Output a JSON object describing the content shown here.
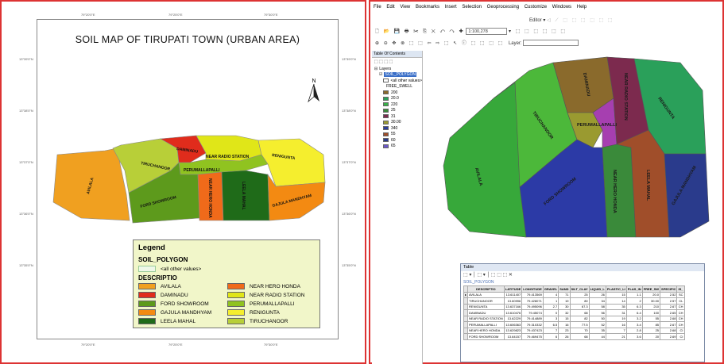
{
  "layout_view": {
    "map_title": "SOIL MAP OF TIRUPATI TOWN  (URBAN AREA)",
    "north_label": "N",
    "grid_ticks_top": [
      "79°20'0\"E",
      "79°25'0\"E",
      "79°30'0\"E"
    ],
    "grid_ticks_bottom": [
      "79°20'0\"E",
      "79°25'0\"E",
      "79°30'0\"E"
    ],
    "grid_ticks_left": [
      "13°39'0\"N",
      "13°38'0\"N",
      "13°37'0\"N",
      "13°36'0\"N",
      "13°35'0\"N"
    ],
    "grid_ticks_right": [
      "13°39'0\"N",
      "13°38'0\"N",
      "13°37'0\"N",
      "13°36'0\"N",
      "13°35'0\"N"
    ],
    "zone_labels": {
      "avilala": "AVILALA",
      "tiruchanoor": "TIRUCHANOOR",
      "daminadu": "DAMINADU",
      "near_radio_station": "NEAR RADIO STATION",
      "renigunta": "RENIGUNTA",
      "perumallapalli": "PERUMALLAPALLI",
      "ford_showroom": "FORD SHOWROOM",
      "near_hero_honda": "NEAR HERO HONDA",
      "leela_mahal": "LEELA MAHAL",
      "gajula_mandhyam": "GAJULA MANDHYAM"
    },
    "legend": {
      "title": "Legend",
      "layer": "SOIL_POLYGON",
      "other_values": "<all other values>",
      "field": "DESCRIPTIO",
      "items": [
        {
          "label": "AVILALA",
          "color": "#f0a020"
        },
        {
          "label": "DAMINADU",
          "color": "#e02c1c"
        },
        {
          "label": "FORD SHOWROOM",
          "color": "#5d9a1c"
        },
        {
          "label": "GAJULA MANDHYAM",
          "color": "#f38a12"
        },
        {
          "label": "LEELA MAHAL",
          "color": "#1f6b19"
        },
        {
          "label": "NEAR HERO HONDA",
          "color": "#f06a1a"
        },
        {
          "label": "NEAR RADIO STATION",
          "color": "#e0e618"
        },
        {
          "label": "PERUMALLAPALLI",
          "color": "#90c320"
        },
        {
          "label": "RENIGUNTA",
          "color": "#f5ee2e"
        },
        {
          "label": "TIRUCHANOOR",
          "color": "#b8cf38"
        }
      ]
    }
  },
  "arcmap": {
    "menu": [
      "File",
      "Edit",
      "View",
      "Bookmarks",
      "Insert",
      "Selection",
      "Geoprocessing",
      "Customize",
      "Windows",
      "Help"
    ],
    "editor_label": "Editor",
    "scale_value": "1:100,278",
    "layer_label": "Layer:",
    "toc": {
      "title": "Table Of Contents",
      "layers_label": "Layers",
      "layer_name": "SOIL_POLYGON",
      "other_values": "<all other values>",
      "field": "FREE_SWELL",
      "classes": [
        {
          "label": "200",
          "color": "#8a6a2c"
        },
        {
          "label": "20.0",
          "color": "#2aa05a"
        },
        {
          "label": "220",
          "color": "#38b048"
        },
        {
          "label": "25",
          "color": "#3a8a3a"
        },
        {
          "label": "31",
          "color": "#7c2a4e"
        },
        {
          "label": "30.00",
          "color": "#9a9a30"
        },
        {
          "label": "340",
          "color": "#2b3d9c"
        },
        {
          "label": "55",
          "color": "#a04e2a"
        },
        {
          "label": "60",
          "color": "#2a3b8c"
        },
        {
          "label": "65",
          "color": "#6b58c8"
        }
      ]
    },
    "map_labels": {
      "daminadu": "DAMINADU",
      "near_radio_station": "NEAR RADIO STATION",
      "renigunta": "RENIGUNTA",
      "tiruchanoor": "TIRUCHANOOR",
      "perumallapalli": "PERUMALLAPALLI",
      "avilala": "AVILALA",
      "ford_showroom": "FORD SHOWROOM",
      "near_hero_honda": "NEAR HERO HONDA",
      "leela_mahal": "LEELA MAHAL",
      "gajula_mandhyam": "GAJULA MANDHYAM"
    },
    "map_colors": {
      "avilala": "#37a83a",
      "tiruchanoor": "#4cb83a",
      "daminadu": "#8a6a2c",
      "perumallapalli": "#a63fb0",
      "near_radio_station": "#7c2a4e",
      "renigunta": "#2aa05a",
      "ford_showroom": "#2c3aa6",
      "near_hero_honda": "#3a8a3a",
      "leela_mahal": "#a04e2a",
      "gajula_mandhyam": "#2a3b8c",
      "north_strip": "#9a9a30"
    },
    "table": {
      "title": "Table",
      "layer_tab": "SOIL_POLYGON",
      "columns": [
        "DESCRIPTIO",
        "LATITUDE",
        "LONGITUDE",
        "GRAVEL",
        "SAND",
        "SILT_CLAY",
        "LIQUID_L",
        "PLASTIC_LI",
        "PLAS_IN",
        "FREE_SW",
        "SPECIFIC",
        "IS_"
      ],
      "rows": [
        [
          "AVILALA",
          "13.611407",
          "79.413569",
          "4",
          "71",
          "25",
          "26",
          "15",
          "1.1",
          "20.0",
          "2.52",
          "SC"
        ],
        [
          "TIRUCHANOOR",
          "13.60996",
          "79.428071",
          "1",
          "19",
          "80",
          "34",
          "14",
          "2",
          "30.00",
          "2.57",
          "CL"
        ],
        [
          "RENIGUNTA",
          "13.637166",
          "79.495096",
          "2.7",
          "30",
          "67.3",
          "58",
          "35",
          "6.3",
          "210",
          "2.67",
          "CH"
        ],
        [
          "DAMINADU",
          "13.610476",
          "79.45074",
          "0",
          "32",
          "68",
          "56",
          "31",
          "6.4",
          "100",
          "2.65",
          "CH"
        ],
        [
          "NEAR RADIO STATION",
          "13.62229",
          "79.414889",
          "3",
          "15",
          "82",
          "50",
          "19",
          "3.2",
          "55",
          "2.68",
          "CH"
        ],
        [
          "PERUMALLAPALLI",
          "13.606363",
          "79.310332",
          "6.5",
          "16",
          "77.5",
          "52",
          "16",
          "3.4",
          "85",
          "2.67",
          "CH"
        ],
        [
          "NEAR HERO HONDA",
          "13.629823",
          "79.437423",
          "7",
          "23",
          "70",
          "35",
          "7",
          "2.8",
          "25",
          "2.68",
          "CI"
        ],
        [
          "FORD SHOWROOM",
          "13.64157",
          "79.469475",
          "6",
          "26",
          "68",
          "44",
          "21",
          "3.6",
          "20",
          "2.69",
          "CI"
        ]
      ]
    }
  }
}
